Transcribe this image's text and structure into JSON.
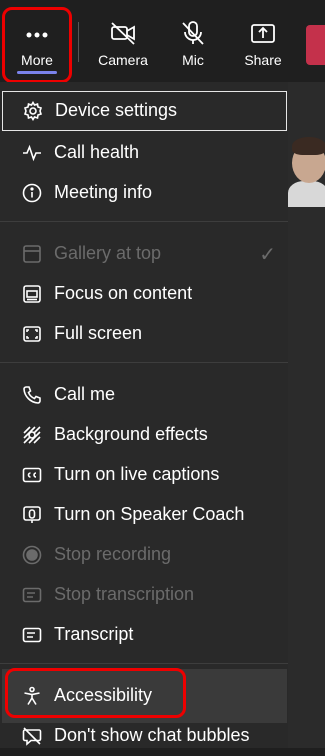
{
  "toolbar": {
    "more_label": "More",
    "camera_label": "Camera",
    "mic_label": "Mic",
    "share_label": "Share"
  },
  "menu": {
    "items": [
      {
        "label": "Device settings",
        "icon": "gear-icon",
        "enabled": true,
        "focused": true
      },
      {
        "label": "Call health",
        "icon": "pulse-icon",
        "enabled": true
      },
      {
        "label": "Meeting info",
        "icon": "info-icon",
        "enabled": true
      },
      {
        "label": "Gallery at top",
        "icon": "gallery-icon",
        "enabled": false,
        "checked": true
      },
      {
        "label": "Focus on content",
        "icon": "focus-icon",
        "enabled": true
      },
      {
        "label": "Full screen",
        "icon": "fullscreen-icon",
        "enabled": true
      },
      {
        "label": "Call me",
        "icon": "phone-icon",
        "enabled": true
      },
      {
        "label": "Background effects",
        "icon": "background-effects-icon",
        "enabled": true
      },
      {
        "label": "Turn on live captions",
        "icon": "captions-icon",
        "enabled": true
      },
      {
        "label": "Turn on Speaker Coach",
        "icon": "speaker-coach-icon",
        "enabled": true
      },
      {
        "label": "Stop recording",
        "icon": "record-icon",
        "enabled": false
      },
      {
        "label": "Stop transcription",
        "icon": "transcription-icon",
        "enabled": false
      },
      {
        "label": "Transcript",
        "icon": "transcript-icon",
        "enabled": true
      },
      {
        "label": "Accessibility",
        "icon": "accessibility-icon",
        "enabled": true,
        "highlighted": true
      },
      {
        "label": "Don't show chat bubbles",
        "icon": "chat-bubble-off-icon",
        "enabled": true
      }
    ],
    "check_mark": "✓"
  },
  "colors": {
    "background": "#292929",
    "highlight_ring": "#e00000",
    "accent_bar": "#7b83eb",
    "leave_button": "#c4314b"
  }
}
